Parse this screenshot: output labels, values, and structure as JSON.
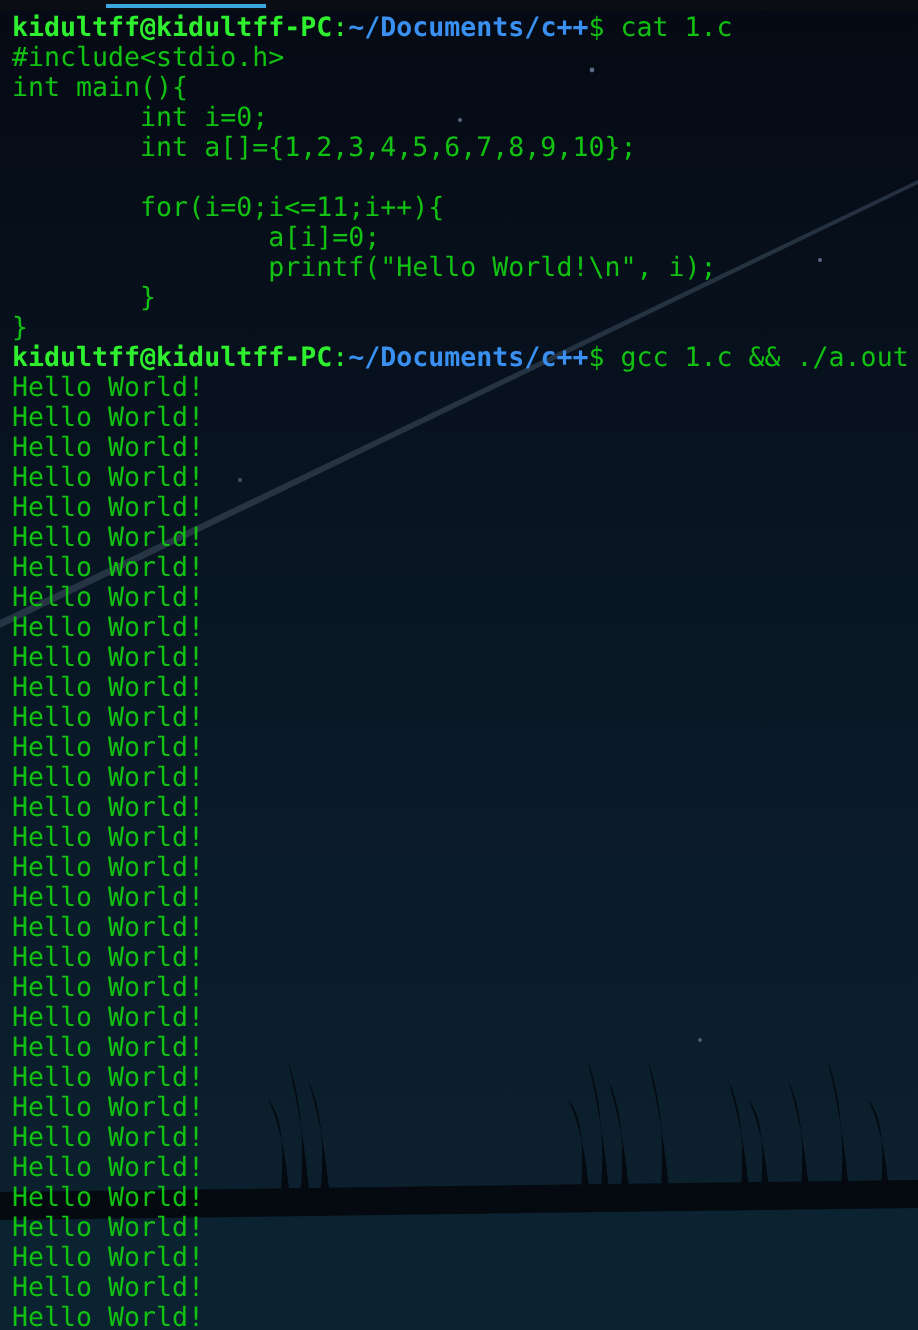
{
  "terminal": {
    "lines": [
      {
        "kind": "prompt",
        "user": "kidultff@kidultff-PC",
        "separator": ":",
        "path": "~/Documents/c++",
        "command": "$ cat 1.c"
      },
      {
        "kind": "output",
        "text": "#include<stdio.h>"
      },
      {
        "kind": "output",
        "text": "int main(){"
      },
      {
        "kind": "output",
        "text": "\tint i=0;"
      },
      {
        "kind": "output",
        "text": "\tint a[]={1,2,3,4,5,6,7,8,9,10};"
      },
      {
        "kind": "blank"
      },
      {
        "kind": "output",
        "text": "\tfor(i=0;i<=11;i++){"
      },
      {
        "kind": "output",
        "text": "\t\ta[i]=0;"
      },
      {
        "kind": "output",
        "text": "\t\tprintf(\"Hello World!\\n\", i);"
      },
      {
        "kind": "output",
        "text": "\t}"
      },
      {
        "kind": "output",
        "text": "}"
      },
      {
        "kind": "prompt",
        "user": "kidultff@kidultff-PC",
        "separator": ":",
        "path": "~/Documents/c++",
        "command": "$ gcc 1.c && ./a.out"
      },
      {
        "kind": "output",
        "text": "Hello World!"
      },
      {
        "kind": "output",
        "text": "Hello World!"
      },
      {
        "kind": "output",
        "text": "Hello World!"
      },
      {
        "kind": "output",
        "text": "Hello World!"
      },
      {
        "kind": "output",
        "text": "Hello World!"
      },
      {
        "kind": "output",
        "text": "Hello World!"
      },
      {
        "kind": "output",
        "text": "Hello World!"
      },
      {
        "kind": "output",
        "text": "Hello World!"
      },
      {
        "kind": "output",
        "text": "Hello World!"
      },
      {
        "kind": "output",
        "text": "Hello World!"
      },
      {
        "kind": "output",
        "text": "Hello World!"
      },
      {
        "kind": "output",
        "text": "Hello World!"
      },
      {
        "kind": "output",
        "text": "Hello World!"
      },
      {
        "kind": "output",
        "text": "Hello World!"
      },
      {
        "kind": "output",
        "text": "Hello World!"
      },
      {
        "kind": "output",
        "text": "Hello World!"
      },
      {
        "kind": "output",
        "text": "Hello World!"
      },
      {
        "kind": "output",
        "text": "Hello World!"
      },
      {
        "kind": "output",
        "text": "Hello World!"
      },
      {
        "kind": "output",
        "text": "Hello World!"
      },
      {
        "kind": "output",
        "text": "Hello World!"
      },
      {
        "kind": "output",
        "text": "Hello World!"
      },
      {
        "kind": "output",
        "text": "Hello World!"
      },
      {
        "kind": "output",
        "text": "Hello World!"
      },
      {
        "kind": "output",
        "text": "Hello World!"
      },
      {
        "kind": "output",
        "text": "Hello World!"
      },
      {
        "kind": "output",
        "text": "Hello World!"
      },
      {
        "kind": "output",
        "text": "Hello World!"
      },
      {
        "kind": "output",
        "text": "Hello World!"
      },
      {
        "kind": "output",
        "text": "Hello World!"
      },
      {
        "kind": "output",
        "text": "Hello World!"
      },
      {
        "kind": "output",
        "text": "Hello World!"
      }
    ]
  }
}
